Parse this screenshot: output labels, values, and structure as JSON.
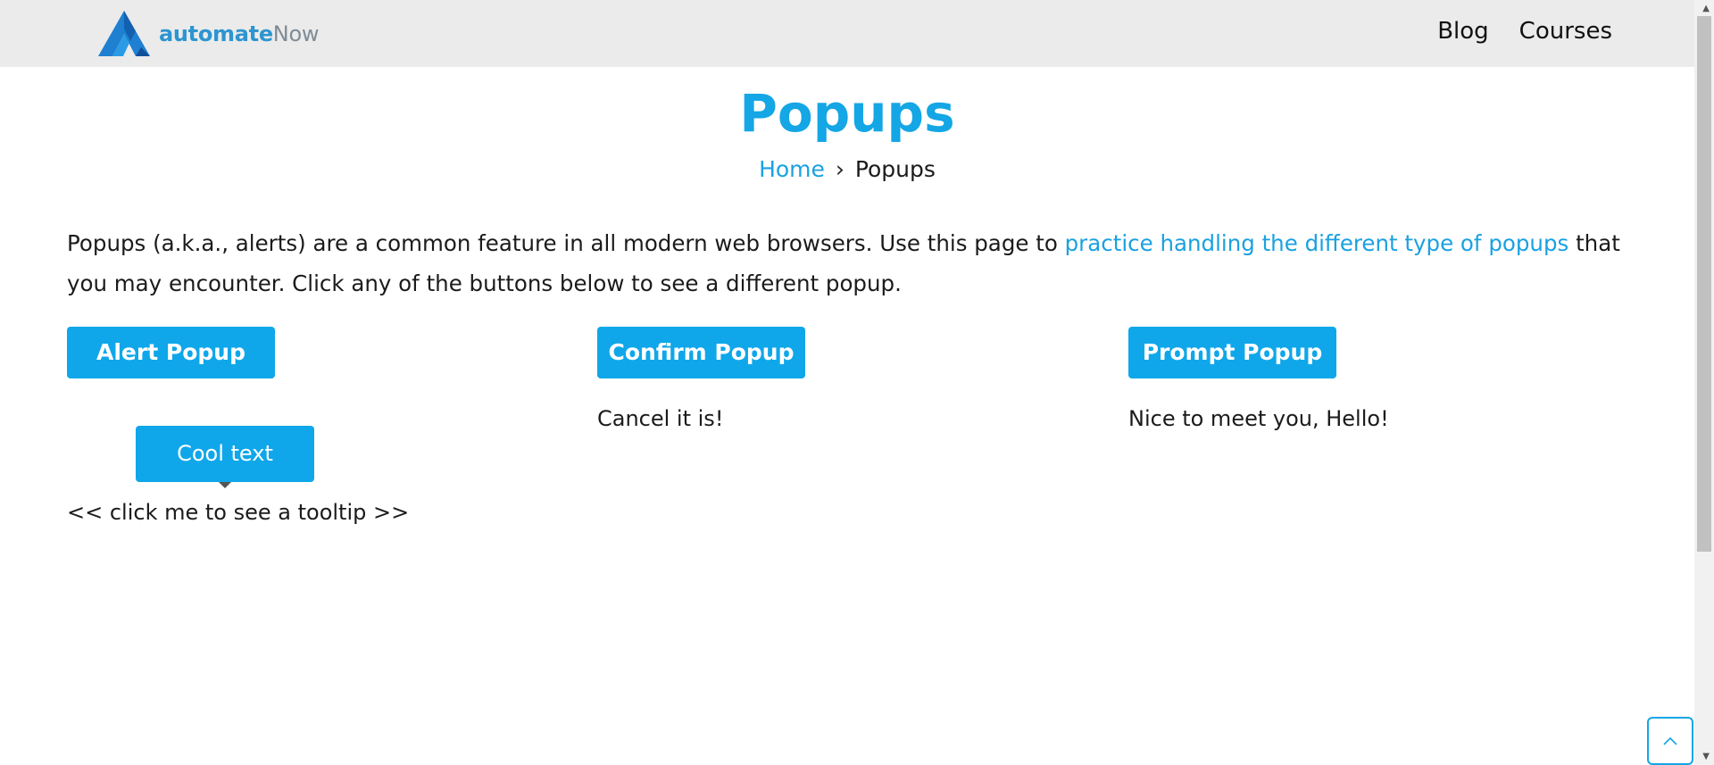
{
  "header": {
    "logo_text_bold": "automate",
    "logo_text_normal": "Now",
    "nav": [
      "Blog",
      "Courses"
    ]
  },
  "page": {
    "title": "Popups",
    "breadcrumb": {
      "home": "Home",
      "separator": "›",
      "current": "Popups"
    },
    "intro_before": "Popups (a.k.a., alerts) are a common feature in all modern web browsers. Use this page to ",
    "intro_link": "practice handling the different type of popups",
    "intro_after": " that you may encounter. Click any of the buttons below to see a different popup."
  },
  "buttons": {
    "alert": "Alert Popup",
    "confirm": "Confirm Popup",
    "prompt": "Prompt Popup"
  },
  "results": {
    "confirm": "Cancel it is!",
    "prompt": "Nice to meet you, Hello!"
  },
  "tooltip": {
    "text": "Cool text",
    "trigger": "<< click me to see a tooltip >>"
  },
  "colors": {
    "accent": "#0fa7ea",
    "header_bg": "#ebebeb",
    "link": "#1aa1e0"
  },
  "icons": [
    "logo-icon",
    "scroll-up-icon",
    "scroll-down-icon",
    "back-to-top-icon"
  ]
}
